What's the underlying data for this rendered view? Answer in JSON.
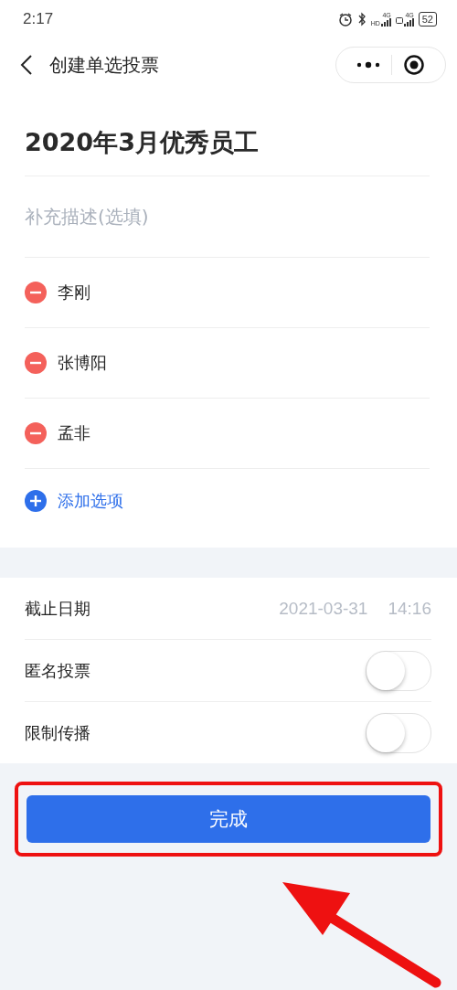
{
  "status_bar": {
    "time": "2:17",
    "network_1": "HD",
    "network_1_type": "4G",
    "network_2_type": "4G",
    "battery": "52"
  },
  "nav": {
    "title": "创建单选投票"
  },
  "poll": {
    "title": "2020年3月优秀员工",
    "description": {
      "placeholder": "补充描述(选填)"
    },
    "options": [
      {
        "label": "李刚"
      },
      {
        "label": "张博阳"
      },
      {
        "label": "孟非"
      }
    ],
    "add_option": "添加选项"
  },
  "settings": [
    {
      "kind": "value",
      "label": "截止日期",
      "date": "2021-03-31",
      "time": "14:16"
    },
    {
      "kind": "switch",
      "label": "匿名投票",
      "on": false
    },
    {
      "kind": "switch",
      "label": "限制传播",
      "on": false
    }
  ],
  "done_button": "完成",
  "annotation": {
    "highlight_frame": true,
    "arrow": true
  }
}
